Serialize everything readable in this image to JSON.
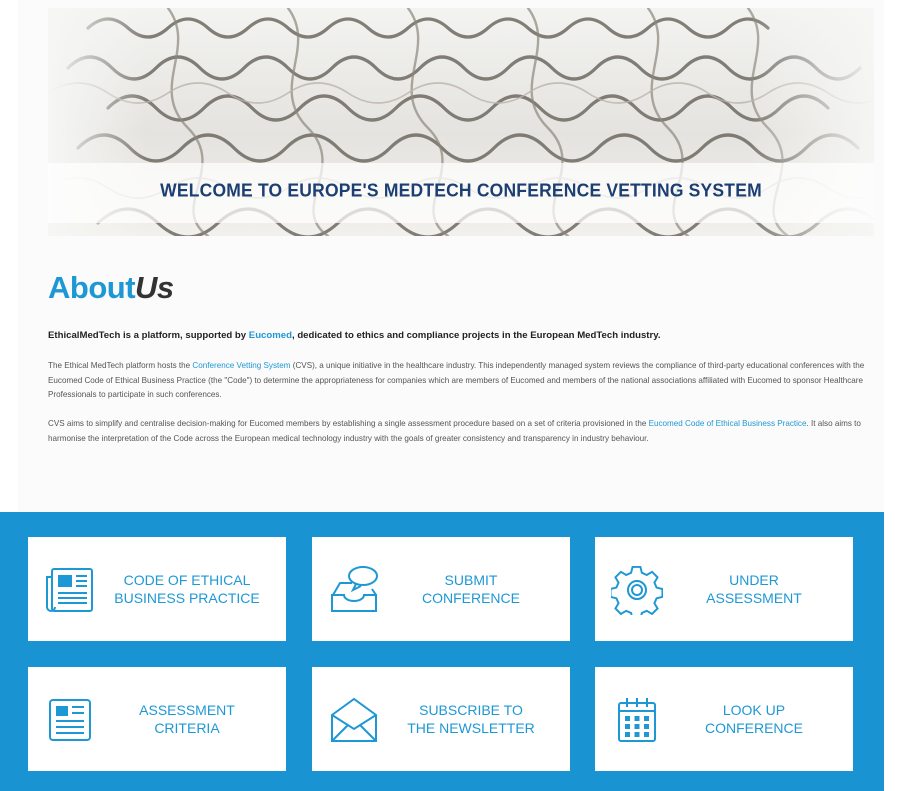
{
  "hero": {
    "title": "WELCOME TO EUROPE'S MEDTECH CONFERENCE VETTING SYSTEM"
  },
  "about": {
    "heading_main": "About",
    "heading_italic": "Us",
    "lead_before": "EthicalMedTech is a platform, supported by ",
    "lead_link": "Eucomed",
    "lead_after": ", dedicated to ethics and compliance projects in the European MedTech industry.",
    "p1_before": "The Ethical MedTech platform hosts the ",
    "p1_link": "Conference Vetting System",
    "p1_after": " (CVS), a unique initiative in the healthcare industry. This independently managed system reviews the compliance of third-party educational conferences with the Eucomed Code of Ethical Business Practice (the \"Code\") to determine the appropriateness for companies which are members of Eucomed and members of the national associations affiliated with Eucomed to sponsor Healthcare Professionals to participate in such conferences.",
    "p2_before": "CVS aims to simplify and centralise decision-making for Eucomed members by establishing a single assessment procedure based on a set of criteria provisioned in the ",
    "p2_link": "Eucomed Code of Ethical Business Practice",
    "p2_after": ". It also aims to harmonise the interpretation of the Code across the European medical technology industry with the goals of greater consistency and transparency in industry behaviour."
  },
  "tiles": [
    {
      "line1": "CODE OF ETHICAL",
      "line2": "BUSINESS PRACTICE",
      "icon": "newspaper-icon"
    },
    {
      "line1": "SUBMIT",
      "line2": "CONFERENCE",
      "icon": "inbox-chat-icon"
    },
    {
      "line1": "UNDER",
      "line2": "ASSESSMENT",
      "icon": "gear-icon"
    },
    {
      "line1": "ASSESSMENT",
      "line2": "CRITERIA",
      "icon": "document-icon"
    },
    {
      "line1": "SUBSCRIBE TO",
      "line2": "THE NEWSLETTER",
      "icon": "envelope-icon"
    },
    {
      "line1": "LOOK UP",
      "line2": "CONFERENCE",
      "icon": "calendar-icon"
    }
  ],
  "colors": {
    "brand_blue": "#1e98d5",
    "grid_blue": "#1a93d2",
    "hero_title": "#1c3f73"
  }
}
